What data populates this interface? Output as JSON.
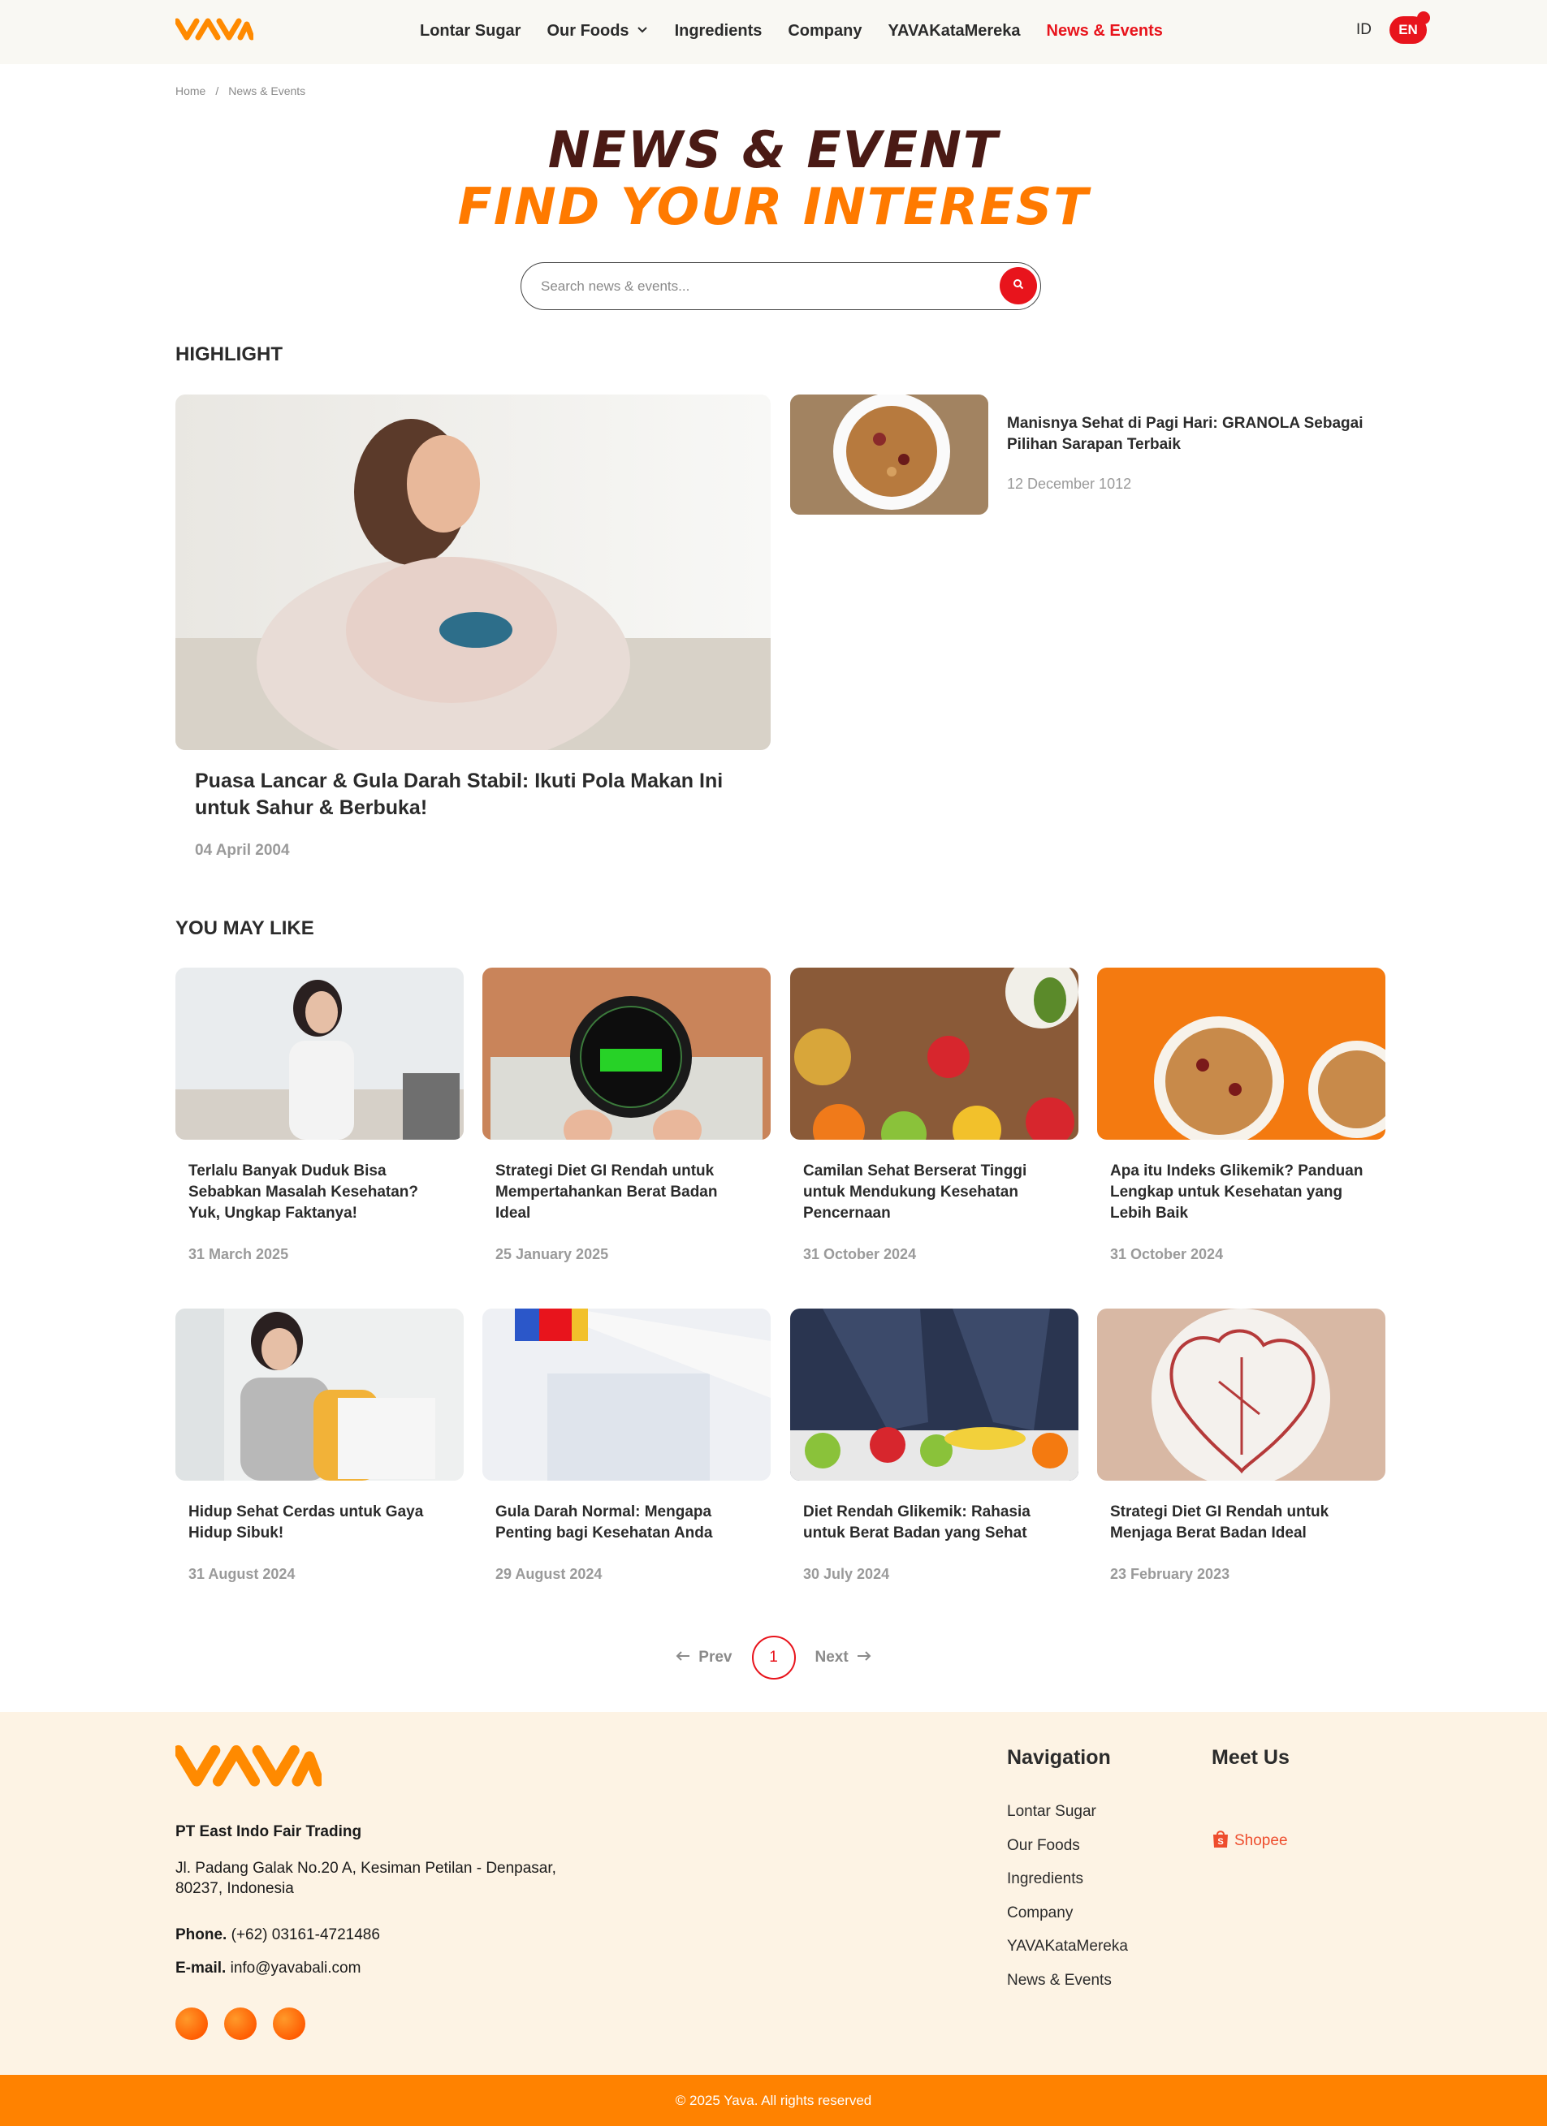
{
  "header": {
    "logo_text": "YAVA",
    "nav": [
      "Lontar Sugar",
      "Our Foods",
      "Ingredients",
      "Company",
      "YAVAKataMereka",
      "News & Events"
    ],
    "lang_id": "ID",
    "lang_en": "EN"
  },
  "breadcrumb": {
    "home": "Home",
    "sep": "/",
    "current": "News & Events"
  },
  "hero": {
    "title": "NEWS & EVENT",
    "subtitle": "FIND YOUR INTEREST"
  },
  "search": {
    "placeholder": "Search news & events..."
  },
  "highlight": {
    "section_title": "HIGHLIGHT",
    "main": {
      "title": "Puasa Lancar & Gula Darah Stabil: Ikuti Pola Makan Ini untuk Sahur & Berbuka!",
      "date": "04 April 2004"
    },
    "side": {
      "title": "Manisnya Sehat di Pagi Hari: GRANOLA Sebagai Pilihan Sarapan Terbaik",
      "date": "12 December 1012"
    }
  },
  "you_may_like": {
    "section_title": "YOU MAY LIKE",
    "cards": [
      {
        "title": "Terlalu Banyak Duduk Bisa Sebabkan Masalah Kesehatan? Yuk, Ungkap Faktanya!",
        "date": "31 March 2025"
      },
      {
        "title": "Strategi Diet GI Rendah untuk Mempertahankan Berat Badan Ideal",
        "date": "25 January 2025"
      },
      {
        "title": "Camilan Sehat Berserat Tinggi untuk Mendukung Kesehatan Pencernaan",
        "date": "31 October 2024"
      },
      {
        "title": "Apa itu Indeks Glikemik? Panduan Lengkap untuk Kesehatan yang Lebih Baik",
        "date": "31 October 2024"
      },
      {
        "title": "Hidup Sehat Cerdas untuk Gaya Hidup Sibuk!",
        "date": "31 August 2024"
      },
      {
        "title": "Gula Darah Normal: Mengapa Penting bagi Kesehatan Anda",
        "date": "29 August 2024"
      },
      {
        "title": "Diet Rendah Glikemik: Rahasia untuk Berat Badan yang Sehat",
        "date": "30 July 2024"
      },
      {
        "title": "Strategi Diet GI Rendah untuk Menjaga Berat Badan Ideal",
        "date": "23 February 2023"
      }
    ]
  },
  "pagination": {
    "prev": "Prev",
    "current_page": "1",
    "next": "Next"
  },
  "footer": {
    "company": "PT East Indo Fair Trading",
    "address": "Jl. Padang Galak No.20 A, Kesiman Petilan - Denpasar, 80237, Indonesia",
    "phone_label": "Phone.",
    "phone": "(+62) 03161-4721486",
    "email_label": "E-mail.",
    "email": "info@yavabali.com",
    "nav_title": "Navigation",
    "nav_items": [
      "Lontar Sugar",
      "Our Foods",
      "Ingredients",
      "Company",
      "YAVAKataMereka",
      "News & Events"
    ],
    "meet_title": "Meet Us",
    "shopee": "Shopee",
    "copyright": "© 2025 Yava. All rights reserved"
  },
  "colors": {
    "brand_orange": "#ff7a00",
    "accent_red": "#e8141c",
    "title_brown": "#4a1a15",
    "footer_bg": "#fdf3e4"
  }
}
